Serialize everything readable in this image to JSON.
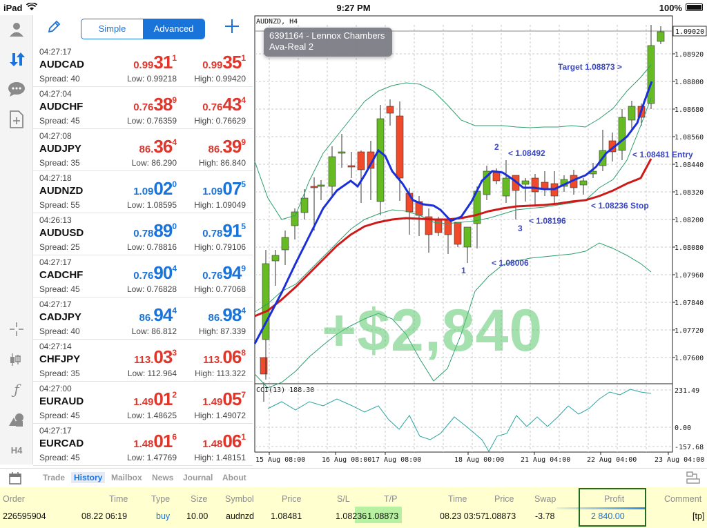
{
  "status_bar": {
    "device": "iPad",
    "time": "9:27 PM",
    "battery": "100%"
  },
  "rail": {
    "icons": [
      "account-icon",
      "quotes-icon",
      "chat-icon",
      "new-order-icon",
      "crosshair-icon",
      "candles-icon",
      "indicator-icon",
      "objects-icon"
    ],
    "timeframe": "H4"
  },
  "quotes_header": {
    "simple_label": "Simple",
    "advanced_label": "Advanced",
    "mode": "Advanced"
  },
  "quotes": [
    {
      "time": "04:27:17",
      "symbol": "AUDCAD",
      "spread": "Spread: 40",
      "bid_pre": "0.99",
      "bid_big": "31",
      "bid_sup": "1",
      "ask_pre": "0.99",
      "ask_big": "35",
      "ask_sup": "1",
      "low": "Low: 0.99218",
      "high": "High: 0.99420",
      "dir": "down"
    },
    {
      "time": "04:27:04",
      "symbol": "AUDCHF",
      "spread": "Spread: 45",
      "bid_pre": "0.76",
      "bid_big": "38",
      "bid_sup": "9",
      "ask_pre": "0.76",
      "ask_big": "43",
      "ask_sup": "4",
      "low": "Low: 0.76359",
      "high": "High: 0.76629",
      "dir": "down"
    },
    {
      "time": "04:27:08",
      "symbol": "AUDJPY",
      "spread": "Spread: 35",
      "bid_pre": "86.",
      "bid_big": "36",
      "bid_sup": "4",
      "ask_pre": "86.",
      "ask_big": "39",
      "ask_sup": "9",
      "low": "Low: 86.290",
      "high": "High: 86.840",
      "dir": "down"
    },
    {
      "time": "04:27:18",
      "symbol": "AUDNZD",
      "spread": "Spread: 55",
      "bid_pre": "1.09",
      "bid_big": "02",
      "bid_sup": "0",
      "ask_pre": "1.09",
      "ask_big": "07",
      "ask_sup": "5",
      "low": "Low: 1.08595",
      "high": "High: 1.09049",
      "dir": "up"
    },
    {
      "time": "04:26:13",
      "symbol": "AUDUSD",
      "spread": "Spread: 25",
      "bid_pre": "0.78",
      "bid_big": "89",
      "bid_sup": "0",
      "ask_pre": "0.78",
      "ask_big": "91",
      "ask_sup": "5",
      "low": "Low: 0.78816",
      "high": "High: 0.79106",
      "dir": "up"
    },
    {
      "time": "04:27:17",
      "symbol": "CADCHF",
      "spread": "Spread: 45",
      "bid_pre": "0.76",
      "bid_big": "90",
      "bid_sup": "4",
      "ask_pre": "0.76",
      "ask_big": "94",
      "ask_sup": "9",
      "low": "Low: 0.76828",
      "high": "High: 0.77068",
      "dir": "up"
    },
    {
      "time": "04:27:17",
      "symbol": "CADJPY",
      "spread": "Spread: 40",
      "bid_pre": "86.",
      "bid_big": "94",
      "bid_sup": "4",
      "ask_pre": "86.",
      "ask_big": "98",
      "ask_sup": "4",
      "low": "Low: 86.812",
      "high": "High: 87.339",
      "dir": "up"
    },
    {
      "time": "04:27:14",
      "symbol": "CHFJPY",
      "spread": "Spread: 35",
      "bid_pre": "113.",
      "bid_big": "03",
      "bid_sup": "3",
      "ask_pre": "113.",
      "ask_big": "06",
      "ask_sup": "8",
      "low": "Low: 112.964",
      "high": "High: 113.322",
      "dir": "down"
    },
    {
      "time": "04:27:00",
      "symbol": "EURAUD",
      "spread": "Spread: 45",
      "bid_pre": "1.49",
      "bid_big": "01",
      "bid_sup": "2",
      "ask_pre": "1.49",
      "ask_big": "05",
      "ask_sup": "7",
      "low": "Low: 1.48625",
      "high": "High: 1.49072",
      "dir": "down"
    },
    {
      "time": "04:27:17",
      "symbol": "EURCAD",
      "spread": "Spread: 45",
      "bid_pre": "1.48",
      "bid_big": "01",
      "bid_sup": "6",
      "ask_pre": "1.48",
      "ask_big": "06",
      "ask_sup": "1",
      "low": "Low: 1.47769",
      "high": "High: 1.48151",
      "dir": "down"
    }
  ],
  "chart": {
    "header": "AUDNZD, H4",
    "tooltip_line1": "6391164 - Lennox Chambers",
    "tooltip_line2": "Ava-Real 2",
    "current_price": "1.09020",
    "price_ticks": [
      "1.08920",
      "1.08800",
      "1.08680",
      "1.08560",
      "1.08440",
      "1.08320",
      "1.08200",
      "1.08080",
      "1.07960",
      "1.07840",
      "1.07720",
      "1.07600"
    ],
    "time_ticks": [
      "15 Aug 08:00",
      "16 Aug 08:00",
      "17 Aug 08:00",
      "18 Aug 00:00",
      "21 Aug 04:00",
      "22 Aug 04:00",
      "23 Aug 04:00"
    ],
    "cci_label": "CCI(13) 188.30",
    "cci_ticks": [
      "231.49",
      "0.00",
      "-157.68"
    ],
    "annotations": [
      "Target 1.08873 >",
      "< 1.08481 Entry",
      "< 1.08236 Stop",
      "< 1.08492",
      "< 1.08196",
      "< 1.08006",
      "1",
      "2",
      "3"
    ],
    "overlay_profit": "+$2,840",
    "colors": {
      "bull": "#66bb22",
      "bear": "#f04a2a",
      "fast_ma": "#1a2fd6",
      "slow_ma": "#cc1a1a",
      "bands": "#2a9e6b",
      "cci": "#2aa3a0",
      "annotation": "#3a46c2"
    }
  },
  "tabs": {
    "items": [
      "Trade",
      "History",
      "Mailbox",
      "News",
      "Journal",
      "About"
    ],
    "active": "History"
  },
  "history": {
    "headers": [
      "Order",
      "Time",
      "Type",
      "Size",
      "Symbol",
      "Price",
      "S/L",
      "T/P",
      "Time",
      "Price",
      "Swap",
      "Profit",
      "Comment"
    ],
    "row": [
      "226595904",
      "08.22 06:19",
      "buy",
      "10.00",
      "audnzd",
      "1.08481",
      "1.08236",
      "1.08873",
      "08.23 03:57",
      "1.08873",
      "-3.78",
      "2 840.00",
      "[tp]"
    ]
  }
}
